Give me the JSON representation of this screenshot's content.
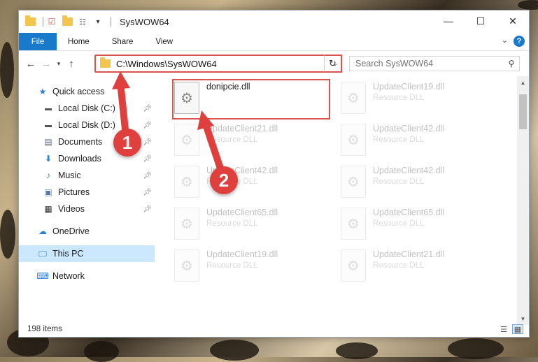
{
  "window": {
    "title": "SysWOW64",
    "controls": {
      "minimize": "—",
      "maximize": "☐",
      "close": "✕"
    }
  },
  "ribbon": {
    "tabs": [
      "File",
      "Home",
      "Share",
      "View"
    ],
    "help": "?"
  },
  "address": {
    "path": "C:\\Windows\\SysWOW64",
    "search_placeholder": "Search SysWOW64"
  },
  "sidebar": {
    "quick_access": "Quick access",
    "items": [
      {
        "label": "Local Disk (C:)",
        "icon": "drive-icon",
        "pinned": true
      },
      {
        "label": "Local Disk (D:)",
        "icon": "drive-icon",
        "pinned": true
      },
      {
        "label": "Documents",
        "icon": "documents-icon",
        "pinned": true
      },
      {
        "label": "Downloads",
        "icon": "downloads-icon",
        "pinned": true
      },
      {
        "label": "Music",
        "icon": "music-icon",
        "pinned": true
      },
      {
        "label": "Pictures",
        "icon": "pictures-icon",
        "pinned": true
      },
      {
        "label": "Videos",
        "icon": "videos-icon",
        "pinned": true
      }
    ],
    "onedrive": "OneDrive",
    "this_pc": "This PC",
    "network": "Network"
  },
  "files": [
    {
      "name": "donipcie.dll",
      "type": "",
      "highlighted": true
    },
    {
      "name": "UpdateClient19.dll",
      "type": "Resource DLL"
    },
    {
      "name": "UpdateClient21.dll",
      "type": "Resource DLL"
    },
    {
      "name": "UpdateClient42.dll",
      "type": "Resource DLL"
    },
    {
      "name": "UpdateClient42.dll",
      "type": "Resource DLL"
    },
    {
      "name": "UpdateClient42.dll",
      "type": "Resource DLL"
    },
    {
      "name": "UpdateClient65.dll",
      "type": "Resource DLL"
    },
    {
      "name": "UpdateClient65.dll",
      "type": "Resource DLL"
    },
    {
      "name": "UpdateClient19.dll",
      "type": "Resource DLL"
    },
    {
      "name": "UpdateClient21.dll",
      "type": "Resource DLL"
    }
  ],
  "status": {
    "item_count": "198 items"
  },
  "callouts": [
    "1",
    "2"
  ],
  "colors": {
    "accent": "#1979ca",
    "highlight": "#d9534f",
    "callout": "#e0403d",
    "selected": "#cce8ff"
  }
}
